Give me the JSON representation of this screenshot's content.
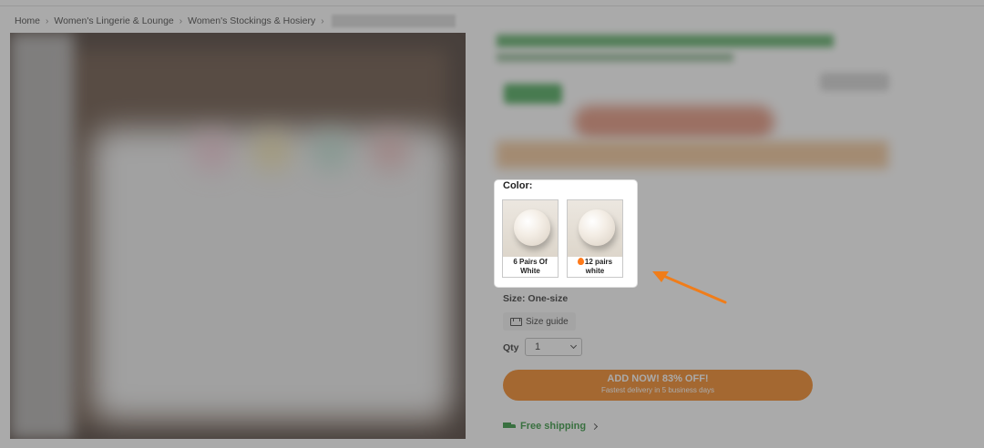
{
  "breadcrumb": {
    "items": [
      "Home",
      "Women's Lingerie & Lounge",
      "Women's Stockings & Hosiery"
    ],
    "separator": "›"
  },
  "color": {
    "label": "Color:",
    "options": [
      {
        "label": "6 Pairs Of White",
        "hot": false
      },
      {
        "label": "12 pairs white",
        "hot": true
      }
    ]
  },
  "size": {
    "label": "Size: One-size",
    "guide_label": "Size guide"
  },
  "qty": {
    "label": "Qty",
    "value": "1"
  },
  "cta": {
    "main": "ADD NOW! 83% OFF!",
    "sub": "Fastest delivery in 5 business days"
  },
  "shipping": {
    "label": "Free shipping"
  },
  "colors": {
    "accent": "#f27a0c",
    "shipping_green": "#1d8a2a",
    "arrow": "#f07d1a"
  }
}
